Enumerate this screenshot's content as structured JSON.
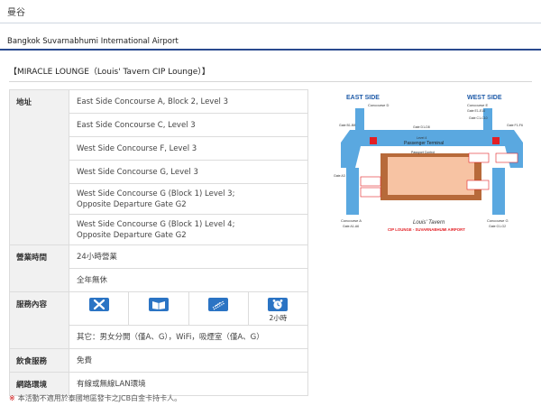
{
  "city": "曼谷",
  "airport": "Bangkok Suvarnabhumi International Airport",
  "lounge_title": "【MIRACLE LOUNGE（Louis' Tavern CIP Lounge）】",
  "rows": {
    "address": {
      "label": "地址",
      "values": [
        [
          "East Side Concourse A, Block 2, Level 3"
        ],
        [
          "East Side Concourse C, Level 3"
        ],
        [
          "West Side Concourse F, Level 3"
        ],
        [
          "West Side Concourse G, Level 3"
        ],
        [
          "West Side Concourse G (Block 1) Level 3;",
          "Opposite Departure Gate G2"
        ],
        [
          "West Side Concourse G (Block 1) Level 4;",
          "Opposite Departure Gate G2"
        ]
      ]
    },
    "hours": {
      "label": "營業時間",
      "values": [
        "24小時營業",
        "全年無休"
      ]
    },
    "services": {
      "label": "服務內容",
      "icons": [
        {
          "name": "no-smoking-icon",
          "caption": ""
        },
        {
          "name": "newspaper-icon",
          "caption": ""
        },
        {
          "name": "wifi-icon",
          "caption": ""
        },
        {
          "name": "clock-icon",
          "caption": "2小時"
        }
      ],
      "other": "其它：男女分開（僅A、G），WiFi，吸煙室（僅A、G）"
    },
    "food": {
      "label": "飲食服務",
      "value": "免費"
    },
    "network": {
      "label": "網路環境",
      "value": "有線或無線LAN環境"
    }
  },
  "footnote": "本活動不適用於泰國地區發卡之JCB白金卡持卡人。",
  "colors": {
    "accent": "#2a4a8f",
    "icon_blue": "#2b74c4",
    "map_red": "#e31e24",
    "map_blue": "#5aa8e0"
  },
  "map": {
    "east_side": "EAST SIDE",
    "west_side": "WEST SIDE",
    "concourse_d": "Concourse D",
    "concourse_e": "Concourse E",
    "gate_d1_d8": "Gate D1-D8",
    "gate_e1_e10": "Gate E1-E10",
    "concourse_a": "Concourse A",
    "concourse_g": "Concourse G",
    "gate_a1_a6": "Gate A1-A6",
    "gate_g1_g2": "Gate G1-G2",
    "passenger_terminal": "Passenger Terminal",
    "level4": "Level 4",
    "passport_control": "Passport Control",
    "gate_b": "Gate B1-B8",
    "gate_c": "Gate C1-C10",
    "gate_f": "Gate F1-F6",
    "gate_a3": "Gate A3",
    "logo": "Louis' Tavern",
    "caption": "CIP LOUNGE - SUVARNABHUMI AIRPORT"
  }
}
